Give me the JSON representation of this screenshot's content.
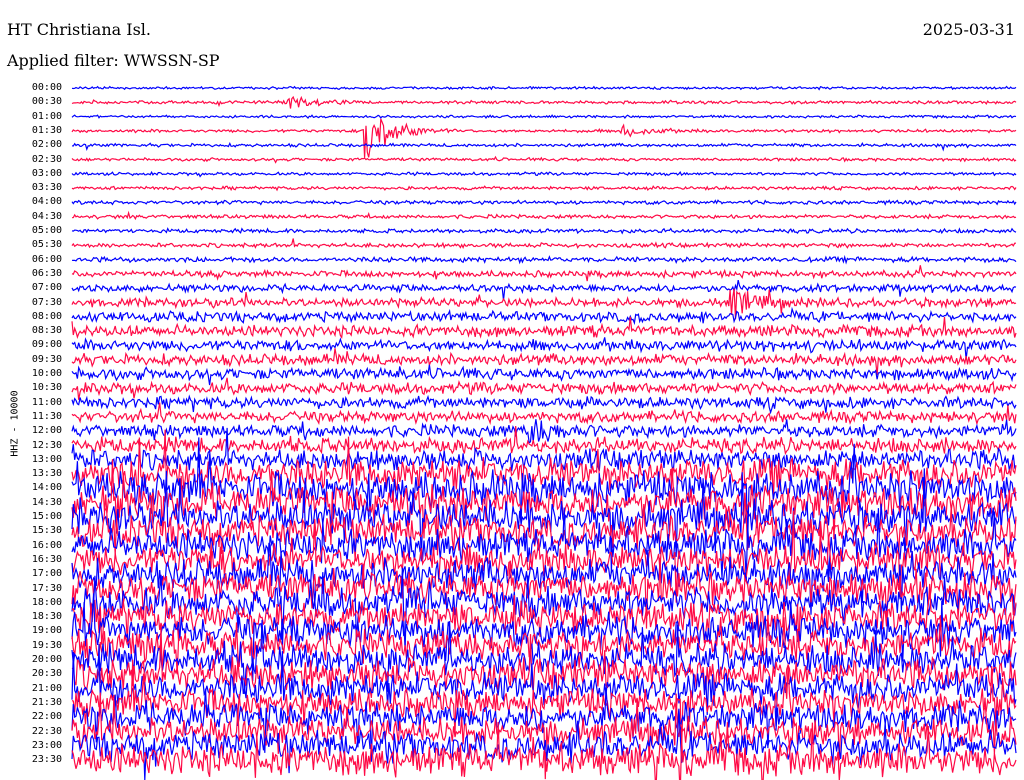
{
  "header": {
    "station": "HT Christiana Isl.",
    "date": "2025-03-31",
    "filter": "Applied filter: WWSSN-SP"
  },
  "chart_data": {
    "type": "line",
    "title": "HT Christiana Isl.",
    "ylabel": "HHZ - 10000",
    "colors": [
      "#0000ff",
      "#ff0a46"
    ],
    "rows": [
      "00:00",
      "00:30",
      "01:00",
      "01:30",
      "02:00",
      "02:30",
      "03:00",
      "03:30",
      "04:00",
      "04:30",
      "05:00",
      "05:30",
      "06:00",
      "06:30",
      "07:00",
      "07:30",
      "08:00",
      "08:30",
      "09:00",
      "09:30",
      "10:00",
      "10:30",
      "11:00",
      "11:30",
      "12:00",
      "12:30",
      "13:00",
      "13:30",
      "14:00",
      "14:30",
      "15:00",
      "15:30",
      "16:00",
      "16:30",
      "17:00",
      "17:30",
      "18:00",
      "18:30",
      "19:00",
      "19:30",
      "20:00",
      "20:30",
      "21:00",
      "21:30",
      "22:00",
      "22:30",
      "23:00",
      "23:30"
    ],
    "row_minutes": 30,
    "noise_level": [
      1,
      1.2,
      1,
      1.2,
      1.3,
      1.2,
      1.2,
      1.3,
      1.5,
      1.5,
      1.6,
      1.7,
      2,
      2.5,
      3,
      3.5,
      4,
      4.5,
      4.5,
      4.5,
      4.5,
      4.5,
      4.5,
      4.5,
      5,
      6,
      8,
      12,
      13,
      13,
      13,
      12,
      12,
      12,
      12,
      12,
      12,
      12,
      12,
      12,
      12,
      12,
      12,
      11,
      11,
      11,
      11,
      12
    ],
    "events": [
      {
        "row": 1,
        "minute": 7,
        "amplitude": 6
      },
      {
        "row": 3,
        "minute": 9.5,
        "amplitude": 28
      },
      {
        "row": 3,
        "minute": 17.6,
        "amplitude": 5
      },
      {
        "row": 15,
        "minute": 21.1,
        "amplitude": 12
      },
      {
        "row": 24,
        "minute": 14.7,
        "amplitude": 10
      }
    ]
  }
}
